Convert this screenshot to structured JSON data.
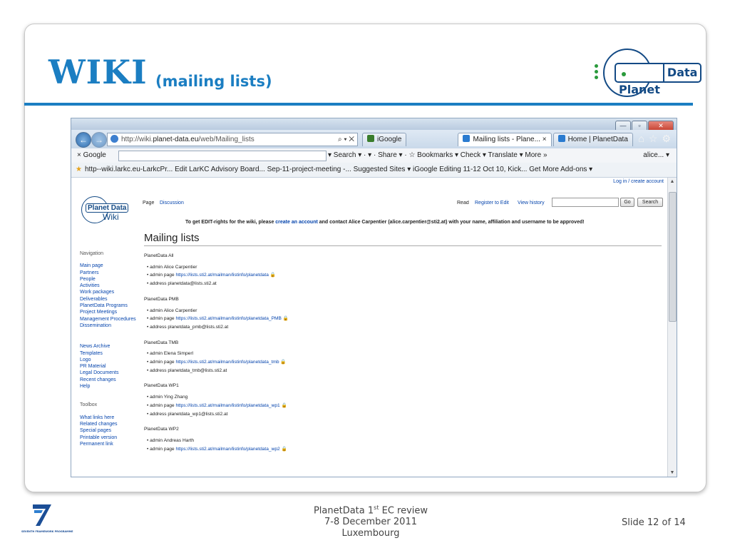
{
  "slide": {
    "title": "WIKI",
    "subtitle": "(mailing lists)",
    "logo_left": "Planet",
    "logo_right": "Data",
    "footer_line1_a": "PlanetData 1",
    "footer_line1_sup": "st",
    "footer_line1_b": " EC review",
    "footer_line2": "7-8 December 2011",
    "footer_line3": "Luxembourg",
    "slide_number": "Slide 12 of 14",
    "fp7_label": "SEVENTH FRAMEWORK PROGRAMME"
  },
  "browser": {
    "url_prefix": "http://wiki.",
    "url_host": "planet-data.eu",
    "url_path": "/web/Mailing_lists",
    "tabs": [
      "iGoogle",
      "Mailing lists - Plane... ×",
      "Home | PlanetData"
    ],
    "google_label": "Google",
    "toolbar_items": "▾  Search ▾  ·  ▾  ·  Share ▾  ·  ☆ Bookmarks ▾   Check ▾   Translate ▾  More »",
    "user_label": "alice... ▾",
    "favorites": "http--wiki.larkc.eu-LarkcPr...   Edit LarKC Advisory Board...   Sep-11-project-meeting -...   Suggested Sites ▾   iGoogle   Editing 11-12 Oct 10, Kick...   Get More Add-ons ▾"
  },
  "wiki": {
    "login": "Log in / create account",
    "logo_text": "Planet Data",
    "logo_sub": "Wiki",
    "tab_page": "Page",
    "tab_discussion": "Discussion",
    "tab_read": "Read",
    "tab_register": "Register to Edit",
    "tab_history": "View history",
    "go_button": "Go",
    "search_button": "Search",
    "notice_a": "To get EDIT-rights for the wiki, please ",
    "notice_link": "create an account",
    "notice_b": " and contact Alice Carpentier (alice.carpentier@sti2.at) with your name, affiliation and username to be approved!",
    "page_title": "Mailing lists",
    "nav_heading": "Navigation",
    "nav_items": [
      "Main page",
      "Partners",
      "People",
      "Activities",
      "Work packages",
      "Deliverables",
      "PlanetData Programs",
      "Project Meetings",
      "Management Procedures",
      "Dissemination"
    ],
    "more_items": [
      "News Archive",
      "Templates",
      "Logo",
      "PR Material",
      "Legal Documents",
      "Recent changes",
      "Help"
    ],
    "toolbox_heading": "Toolbox",
    "toolbox_items": [
      "What links here",
      "Related changes",
      "Special pages",
      "Printable version",
      "Permanent link"
    ],
    "sections": [
      {
        "name": "PlanetData All",
        "admin": "admin Alice Carpentier",
        "page_label": "admin page ",
        "page_url": "https://lists.sti2.at/mailman/listinfo/planetdata",
        "address": "address planetdata@lists.sti2.at"
      },
      {
        "name": "PlanetData PMB",
        "admin": "admin Alice Carpentier",
        "page_label": "admin page ",
        "page_url": "https://lists.sti2.at/mailman/listinfo/planetdata_PMB",
        "address": "address planetdata_pmb@lists.sti2.at"
      },
      {
        "name": "PlanetData TMB",
        "admin": "admin Elena Simperl",
        "page_label": "admin page ",
        "page_url": "https://lists.sti2.at/mailman/listinfo/planetdata_tmb",
        "address": "address planetdata_tmb@lists.sti2.at"
      },
      {
        "name": "PlanetData WP1",
        "admin": "admin Ying Zhang",
        "page_label": "admin page ",
        "page_url": "https://lists.sti2.at/mailman/listinfo/planetdata_wp1",
        "address": "address planetdata_wp1@lists.sti2.at"
      },
      {
        "name": "PlanetData WP2",
        "admin": "admin Andreas Harth",
        "page_label": "admin page ",
        "page_url": "https://lists.sti2.at/mailman/listinfo/planetdata_wp2",
        "address": ""
      }
    ]
  }
}
